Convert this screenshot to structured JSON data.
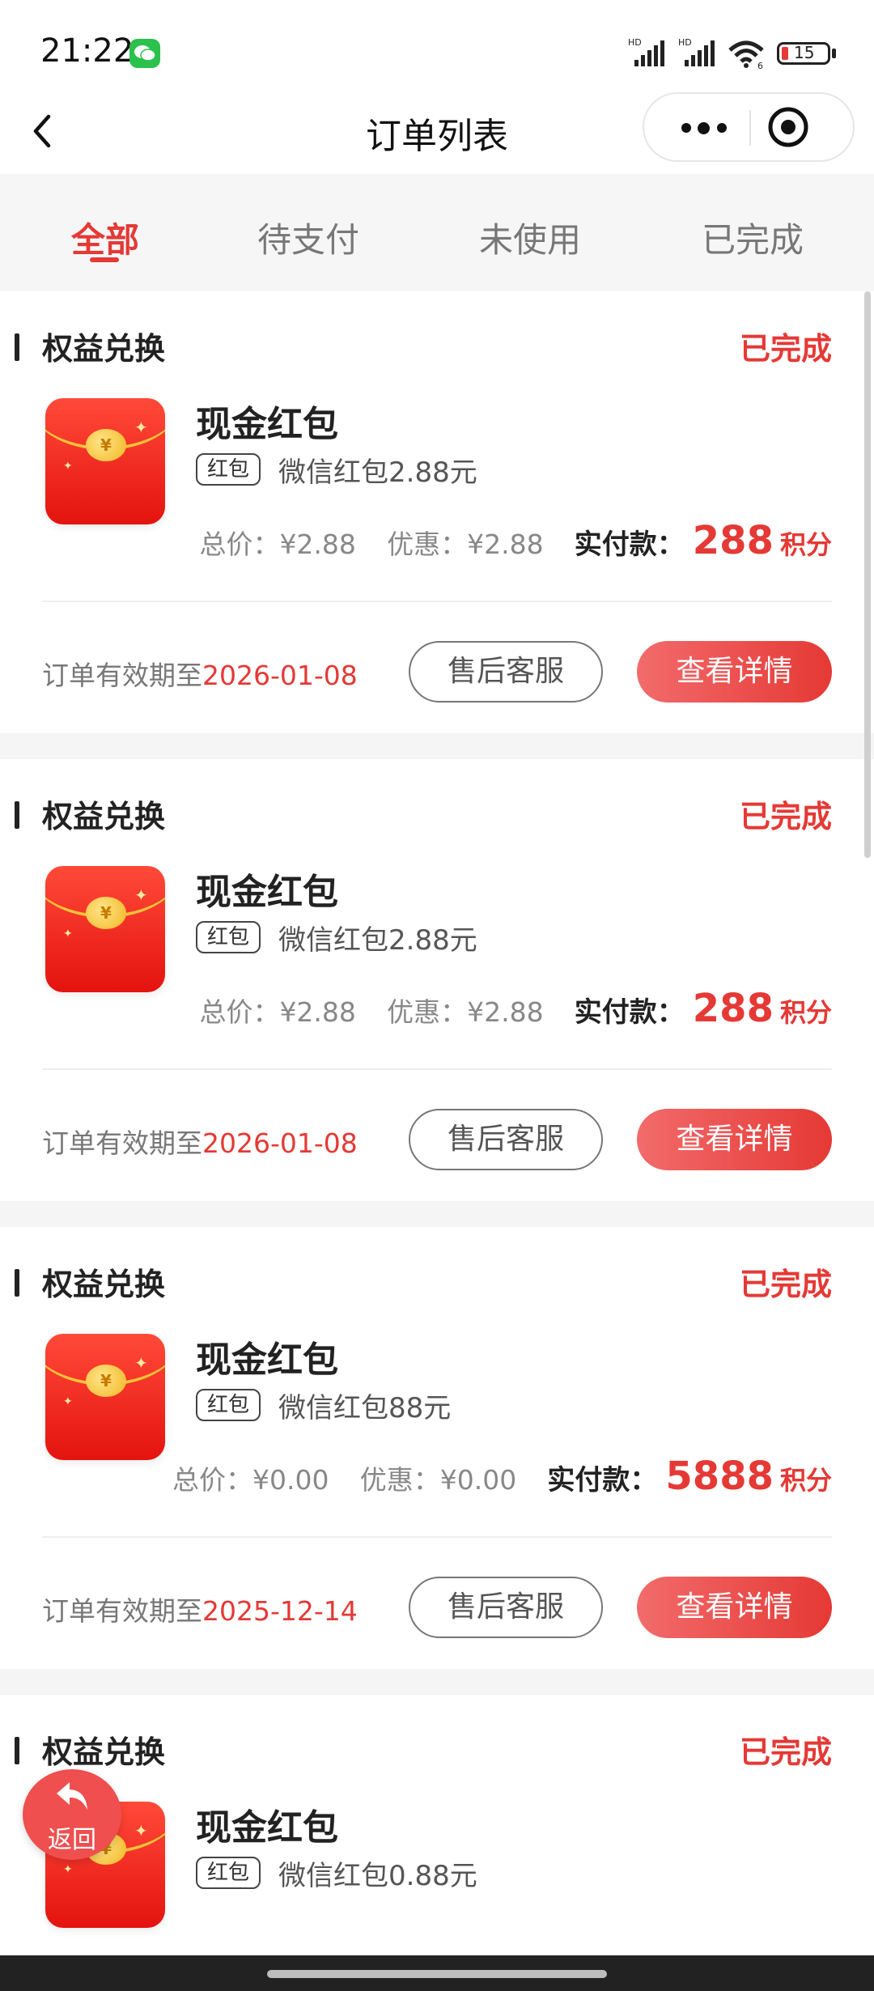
{
  "status_bar": {
    "time": "21:22",
    "battery": "15",
    "signal1": "HD",
    "signal2": "HD",
    "wifi_badge": "6"
  },
  "header": {
    "title": "订单列表"
  },
  "tabs": [
    {
      "label": "全部",
      "active": true
    },
    {
      "label": "待支付",
      "active": false
    },
    {
      "label": "未使用",
      "active": false
    },
    {
      "label": "已完成",
      "active": false
    }
  ],
  "orders": [
    {
      "type": "权益兑换",
      "status": "已完成",
      "name": "现金红包",
      "tag": "红包",
      "desc": "微信红包2.88元",
      "total_label": "总价：",
      "total": "¥2.88",
      "discount_label": "优惠：",
      "discount": "¥2.88",
      "pay_label": "实付款：",
      "pay": "288",
      "pay_unit": "积分",
      "validity_label": "订单有效期至",
      "validity_date": "2026-01-08",
      "service_label": "售后客服",
      "detail_label": "查看详情"
    },
    {
      "type": "权益兑换",
      "status": "已完成",
      "name": "现金红包",
      "tag": "红包",
      "desc": "微信红包2.88元",
      "total_label": "总价：",
      "total": "¥2.88",
      "discount_label": "优惠：",
      "discount": "¥2.88",
      "pay_label": "实付款：",
      "pay": "288",
      "pay_unit": "积分",
      "validity_label": "订单有效期至",
      "validity_date": "2026-01-08",
      "service_label": "售后客服",
      "detail_label": "查看详情"
    },
    {
      "type": "权益兑换",
      "status": "已完成",
      "name": "现金红包",
      "tag": "红包",
      "desc": "微信红包88元",
      "total_label": "总价：",
      "total": "¥0.00",
      "discount_label": "优惠：",
      "discount": "¥0.00",
      "pay_label": "实付款：",
      "pay": "5888",
      "pay_unit": "积分",
      "validity_label": "订单有效期至",
      "validity_date": "2025-12-14",
      "service_label": "售后客服",
      "detail_label": "查看详情"
    },
    {
      "type": "权益兑换",
      "status": "已完成",
      "name": "现金红包",
      "tag": "红包",
      "desc": "微信红包0.88元"
    }
  ],
  "float_back": {
    "label": "返回"
  },
  "icons": {
    "back": "chevron-left-icon",
    "more": "more-dots-icon",
    "close": "target-circle-icon",
    "wechat": "wechat-icon",
    "signal": "signal-icon",
    "wifi": "wifi-icon",
    "battery": "battery-icon",
    "red_envelope": "red-envelope-icon",
    "float_back": "undo-arrow-icon"
  },
  "colors": {
    "accent": "#e53935",
    "background": "#f5f5f5"
  }
}
